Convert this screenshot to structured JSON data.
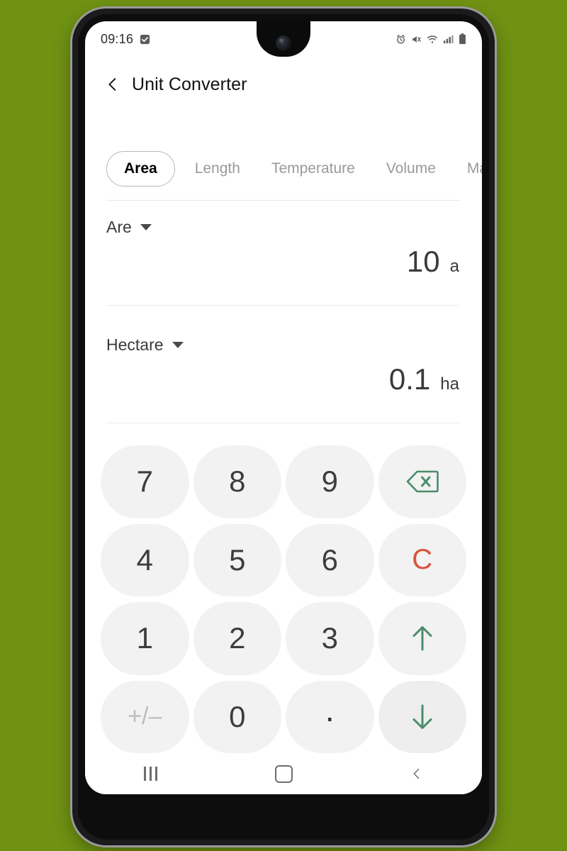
{
  "background_color": "#6f9213",
  "status_bar": {
    "time": "09:16",
    "left_icons": [
      "checkbox-checked-icon"
    ],
    "right_icons": [
      "alarm-icon",
      "mute-vibrate-icon",
      "wifi-icon",
      "signal-icon",
      "battery-icon"
    ]
  },
  "app_bar": {
    "back_icon": "back-chevron-icon",
    "title": "Unit Converter"
  },
  "tabs": [
    {
      "label": "Area",
      "active": true
    },
    {
      "label": "Length",
      "active": false
    },
    {
      "label": "Temperature",
      "active": false
    },
    {
      "label": "Volume",
      "active": false
    },
    {
      "label": "Ma",
      "active": false
    }
  ],
  "converter": {
    "from": {
      "unit_name": "Are",
      "value": "10",
      "symbol": "a",
      "dropdown_icon": "chevron-down-icon"
    },
    "to": {
      "unit_name": "Hectare",
      "value": "0.1",
      "symbol": "ha",
      "dropdown_icon": "chevron-down-icon"
    }
  },
  "keypad": {
    "keys": [
      {
        "label": "7",
        "name": "key-7",
        "style": "num"
      },
      {
        "label": "8",
        "name": "key-8",
        "style": "num"
      },
      {
        "label": "9",
        "name": "key-9",
        "style": "num"
      },
      {
        "label": "",
        "name": "key-backspace",
        "style": "icon-backspace"
      },
      {
        "label": "4",
        "name": "key-4",
        "style": "num"
      },
      {
        "label": "5",
        "name": "key-5",
        "style": "num"
      },
      {
        "label": "6",
        "name": "key-6",
        "style": "num"
      },
      {
        "label": "C",
        "name": "key-clear",
        "style": "clear"
      },
      {
        "label": "1",
        "name": "key-1",
        "style": "num"
      },
      {
        "label": "2",
        "name": "key-2",
        "style": "num"
      },
      {
        "label": "3",
        "name": "key-3",
        "style": "num"
      },
      {
        "label": "",
        "name": "key-arrow-up",
        "style": "icon-up"
      },
      {
        "label": "+/–",
        "name": "key-sign-toggle",
        "style": "dim"
      },
      {
        "label": "0",
        "name": "key-0",
        "style": "num"
      },
      {
        "label": "·",
        "name": "key-decimal",
        "style": "dot"
      },
      {
        "label": "",
        "name": "key-arrow-down",
        "style": "icon-down"
      }
    ],
    "accent_green": "#4a8c6a",
    "clear_color": "#d9543d",
    "key_background": "#f2f2f2"
  },
  "nav_bar": {
    "recents": "recents-icon",
    "home": "home-icon",
    "back": "back-icon"
  }
}
